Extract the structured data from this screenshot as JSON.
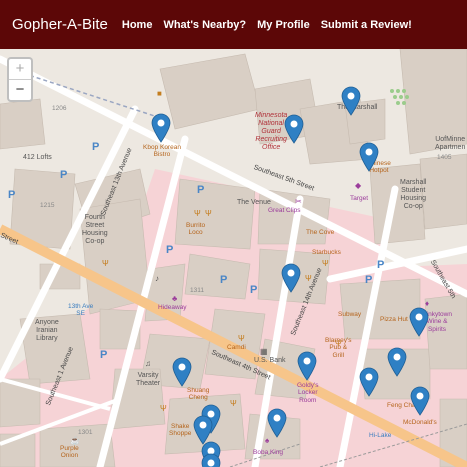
{
  "nav": {
    "brand": "Gopher-A-Bite",
    "links": [
      "Home",
      "What's Nearby?",
      "My Profile",
      "Submit a Review!"
    ]
  },
  "zoom": {
    "in": "+",
    "out": "−"
  },
  "map": {
    "numbers": {
      "n1206": "1206",
      "n1215": "1215",
      "n1311": "1311",
      "n1301": "1301",
      "n1405": "1405"
    },
    "places": {
      "lofts": "412 Lofts",
      "fourth_street": "Fourth\nStreet\nHousing\nCo-op",
      "kbop": "Kbop Korean\nBistro",
      "recruiting": "Minnesota\nNational\nGuard\nRecruiting\nOffice",
      "marshall": "The Marshall",
      "hotpot": "Chinese\nHotpot",
      "marshall_coop": "Marshall\nStudent\nHousing\nCo-op",
      "uofm": "UofMinne\nApartmen",
      "target": "Target",
      "venue": "The Venue",
      "great_clips": "Great Clips",
      "burrito": "Burrito\nLoco",
      "the_cove": "The Cove",
      "starbucks": "Starbucks",
      "hideaway": "Hideaway",
      "ave_13th": "13th Ave\nSE",
      "library": "Anyone\nIranian\nLibrary",
      "subway": "Subway",
      "pizza_hut": "Pizza Hut",
      "dinkytown": "Dinkytown\nWine &\nSpirits",
      "blarney": "Blarney's\nPub &\nGrill",
      "us_bank": "U.S. Bank",
      "varsity": "Varsity\nTheater",
      "camdi": "Camdi",
      "shuang": "Shuang\nCheng",
      "goldys": "Goldy's\nLocker\nRoom",
      "feng_cha": "Feng Cha",
      "mcdonalds": "McDonald's",
      "shake": "Shake\nShoppe",
      "boba": "Boba King",
      "hi_lake": "Hi-Lake",
      "purple_onion": "Purple\nOnion",
      "st_13th_ave": "Southeast 13th Avenue",
      "st_5th": "Southeast 5th Street",
      "st_14th_ave": "Southeast 14th Avenue",
      "st_4th": "Southeast 4th Street",
      "st_1st_ave": "Southeast 1 Avenue",
      "st_left": "Street",
      "st_right": "Southeast 5th"
    },
    "markers": [
      "marker",
      "marker",
      "marker",
      "marker",
      "marker",
      "marker",
      "marker",
      "marker",
      "marker",
      "marker",
      "marker",
      "marker",
      "marker",
      "marker",
      "marker",
      "marker"
    ]
  },
  "colors": {
    "nav": "#5c0707",
    "marker": "#2f80c4",
    "campus_pink": "#f6d3d6",
    "building": "#d9cfc5"
  }
}
